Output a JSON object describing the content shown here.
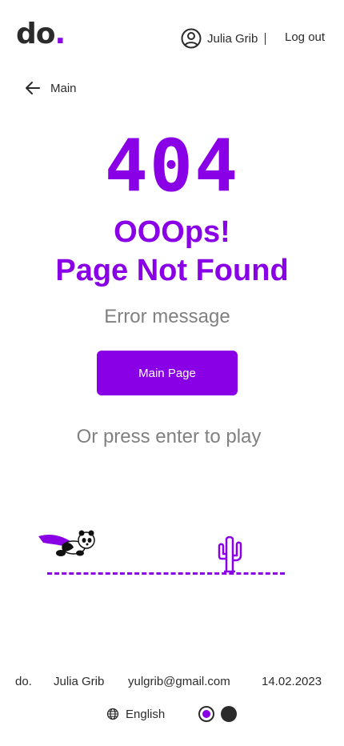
{
  "header": {
    "logo_text": "do",
    "logo_dot": ".",
    "user_name": "Julia Grib",
    "logout_label": "Log out"
  },
  "nav": {
    "back_label": "Main"
  },
  "error": {
    "code": "404",
    "title_line1": "OOOps!",
    "title_line2": "Page Not Found",
    "message": "Error message",
    "button_label": "Main Page",
    "play_hint": "Or press enter to play"
  },
  "footer": {
    "brand": "do.",
    "author": "Julia Grib",
    "email": "yulgrib@gmail.com",
    "date": "14.02.2023",
    "language": "English"
  },
  "colors": {
    "accent": "#8a00e6",
    "text": "#2b2b2b",
    "muted": "#808080"
  },
  "icons": [
    "user-icon",
    "arrow-left-icon",
    "globe-icon",
    "panda-icon",
    "cactus-icon"
  ]
}
